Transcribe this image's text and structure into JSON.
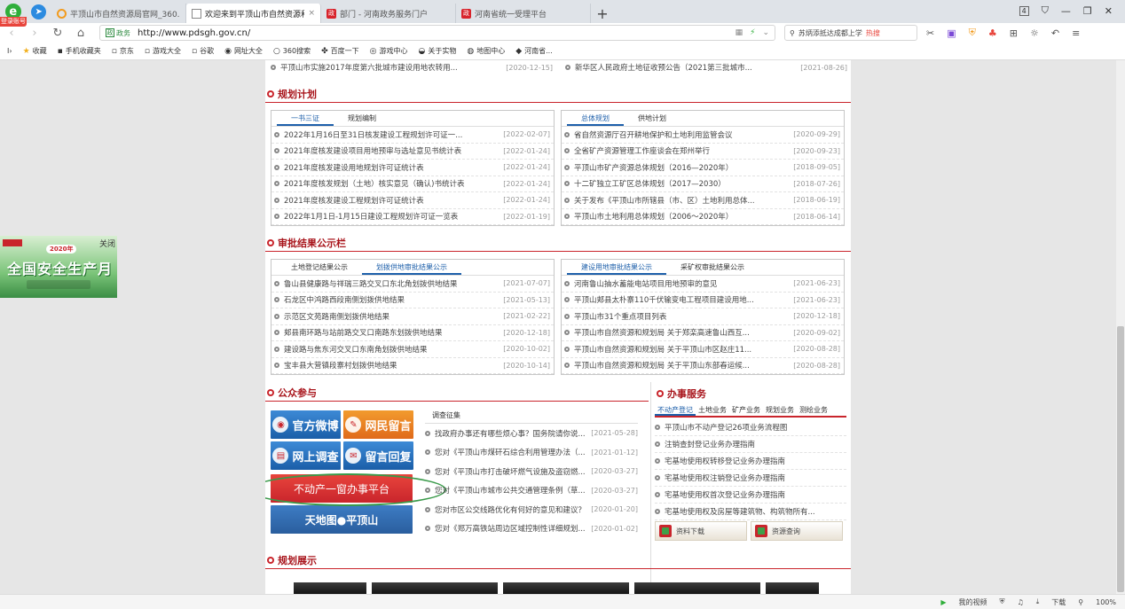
{
  "browser": {
    "tabs": [
      {
        "title": "平顶山市自然资源局官网_360...",
        "icon": "360"
      },
      {
        "title": "欢迎来到平顶山市自然资源和规...",
        "icon": "page",
        "active": true
      },
      {
        "title": "部门 - 河南政务服务门户",
        "icon": "gov"
      },
      {
        "title": "河南省统一受理平台",
        "icon": "gov"
      }
    ],
    "new_tab": "+",
    "login_badge": "登录账号",
    "window_count": "4",
    "address": {
      "gov_label": "政务",
      "url": "http://www.pdsgh.gov.cn/"
    },
    "search": {
      "text": "苏炳添抵达成都上学",
      "hot": "热搜"
    },
    "bookmarks": [
      "收藏",
      "手机收藏夹",
      "京东",
      "游戏大全",
      "谷歌",
      "网址大全",
      "360搜索",
      "百度一下",
      "游戏中心",
      "关于实物",
      "地图中心",
      "河南省..."
    ]
  },
  "top_strip": {
    "left": {
      "text": "平顶山市实施2017年度第六批城市建设用地农转用...",
      "date": "[2020-12-15]"
    },
    "right": {
      "text": "新华区人民政府土地征收预公告（2021第三批城市...",
      "date": "[2021-08-26]"
    }
  },
  "planning": {
    "title": "规划计划",
    "left_tabs": [
      "一书三证",
      "规划编制"
    ],
    "right_tabs": [
      "总体规划",
      "供地计划"
    ],
    "left_items": [
      {
        "text": "2022年1月16日至31日核发建设工程规划许可证一...",
        "date": "[2022-02-07]"
      },
      {
        "text": "2021年度核发建设项目用地预审与选址意见书统计表",
        "date": "[2022-01-24]"
      },
      {
        "text": "2021年度核发建设用地规划许可证统计表",
        "date": "[2022-01-24]"
      },
      {
        "text": "2021年度核发规划（土地）核实意见（确认)书统计表",
        "date": "[2022-01-24]"
      },
      {
        "text": "2021年度核发建设工程规划许可证统计表",
        "date": "[2022-01-24]"
      },
      {
        "text": "2022年1月1日-1月15日建设工程规划许可证一览表",
        "date": "[2022-01-19]"
      }
    ],
    "right_items": [
      {
        "text": "省自然资源厅召开耕地保护和土地利用监管会议",
        "date": "[2020-09-29]"
      },
      {
        "text": "全省矿产资源管理工作座谈会在郑州举行",
        "date": "[2020-09-23]"
      },
      {
        "text": "平顶山市矿产资源总体规划（2016—2020年）",
        "date": "[2018-09-05]"
      },
      {
        "text": "十二矿独立工矿区总体规划（2017—2030）",
        "date": "[2018-07-26]"
      },
      {
        "text": "关于发布《平顶山市所辖县（市、区）土地利用总体...",
        "date": "[2018-06-19]"
      },
      {
        "text": "平顶山市土地利用总体规划（2006～2020年）",
        "date": "[2018-06-14]"
      }
    ]
  },
  "approval": {
    "title": "审批结果公示栏",
    "left_tabs": [
      "土地登记结果公示",
      "划拨供地审批结果公示"
    ],
    "right_tabs": [
      "建设用地审批结果公示",
      "采矿权审批结果公示"
    ],
    "left_items": [
      {
        "text": "鲁山县健康路与祥瑞三路交叉口东北角划拨供地结果",
        "date": "[2021-07-07]"
      },
      {
        "text": "石龙区中鸿路西段南侧划拨供地结果",
        "date": "[2021-05-13]"
      },
      {
        "text": "示范区文苑路南侧划拨供地结果",
        "date": "[2021-02-22]"
      },
      {
        "text": "郏县南环路与站前路交叉口南路东划拨供地结果",
        "date": "[2020-12-18]"
      },
      {
        "text": "建设路与焦东河交叉口东南角划拨供地结果",
        "date": "[2020-10-02]"
      },
      {
        "text": "宝丰县大营镇段寨村划拨供地结果",
        "date": "[2020-10-14]"
      }
    ],
    "right_items": [
      {
        "text": "河南鲁山抽水蓄能电站项目用地预审的意见",
        "date": "[2021-06-23]"
      },
      {
        "text": "平顶山郏县太朴寨110千伏输变电工程项目建设用地...",
        "date": "[2021-06-23]"
      },
      {
        "text": "平顶山市31个重点项目列表",
        "date": "[2020-12-18]"
      },
      {
        "text": "平顶山市自然资源和规划局 关于郑栾高速鲁山西互...",
        "date": "[2020-09-02]"
      },
      {
        "text": "平顶山市自然资源和规划局 关于平顶山市区赵庄11...",
        "date": "[2020-08-28]"
      },
      {
        "text": "平顶山市自然资源和规划局 关于平顶山东部春运候...",
        "date": "[2020-08-28]"
      }
    ]
  },
  "public": {
    "title": "公众参与",
    "buttons": {
      "weibo": "官方微博",
      "message": "网民留言",
      "survey": "网上调查",
      "reply": "留言回复",
      "realestate": "不动产一窗办事平台",
      "map": "天地图●平顶山"
    },
    "survey_tab": "调查征集",
    "survey_items": [
      {
        "text": "找政府办事还有哪些烦心事？国务院请你说...",
        "date": "[2021-05-28]"
      },
      {
        "text": "您对《平顶山市煤矸石综合利用管理办法（...",
        "date": "[2021-01-12]"
      },
      {
        "text": "您对《平顶山市打击破坏燃气设施及盗窃燃...",
        "date": "[2020-03-27]"
      },
      {
        "text": "您对《平顶山市城市公共交通管理条例（草...",
        "date": "[2020-03-27]"
      },
      {
        "text": "您对市区公交线路优化有何好的意见和建议？",
        "date": "[2020-01-20]"
      },
      {
        "text": "您对《郑万高铁站周边区域控制性详细规划...",
        "date": "[2020-01-02]"
      }
    ]
  },
  "affairs": {
    "title": "办事服务",
    "tabs": [
      "不动产登记",
      "土地业务",
      "矿产业务",
      "规划业务",
      "测绘业务"
    ],
    "items": [
      "平顶山市不动产登记26项业务流程图",
      "注销查封登记业务办理指南",
      "宅基地使用权转移登记业务办理指南",
      "宅基地使用权注销登记业务办理指南",
      "宅基地使用权首次登记业务办理指南",
      "宅基地使用权及房屋等建筑物、构筑物所有..."
    ],
    "buttons": [
      "资料下载",
      "资源查询"
    ]
  },
  "showcase": {
    "title": "规划展示"
  },
  "float_ad": {
    "close": "关闭",
    "year": "2020年",
    "title": "全国安全生产月"
  },
  "statusbar": {
    "items": [
      "我的视频",
      "下载",
      "100%"
    ]
  }
}
